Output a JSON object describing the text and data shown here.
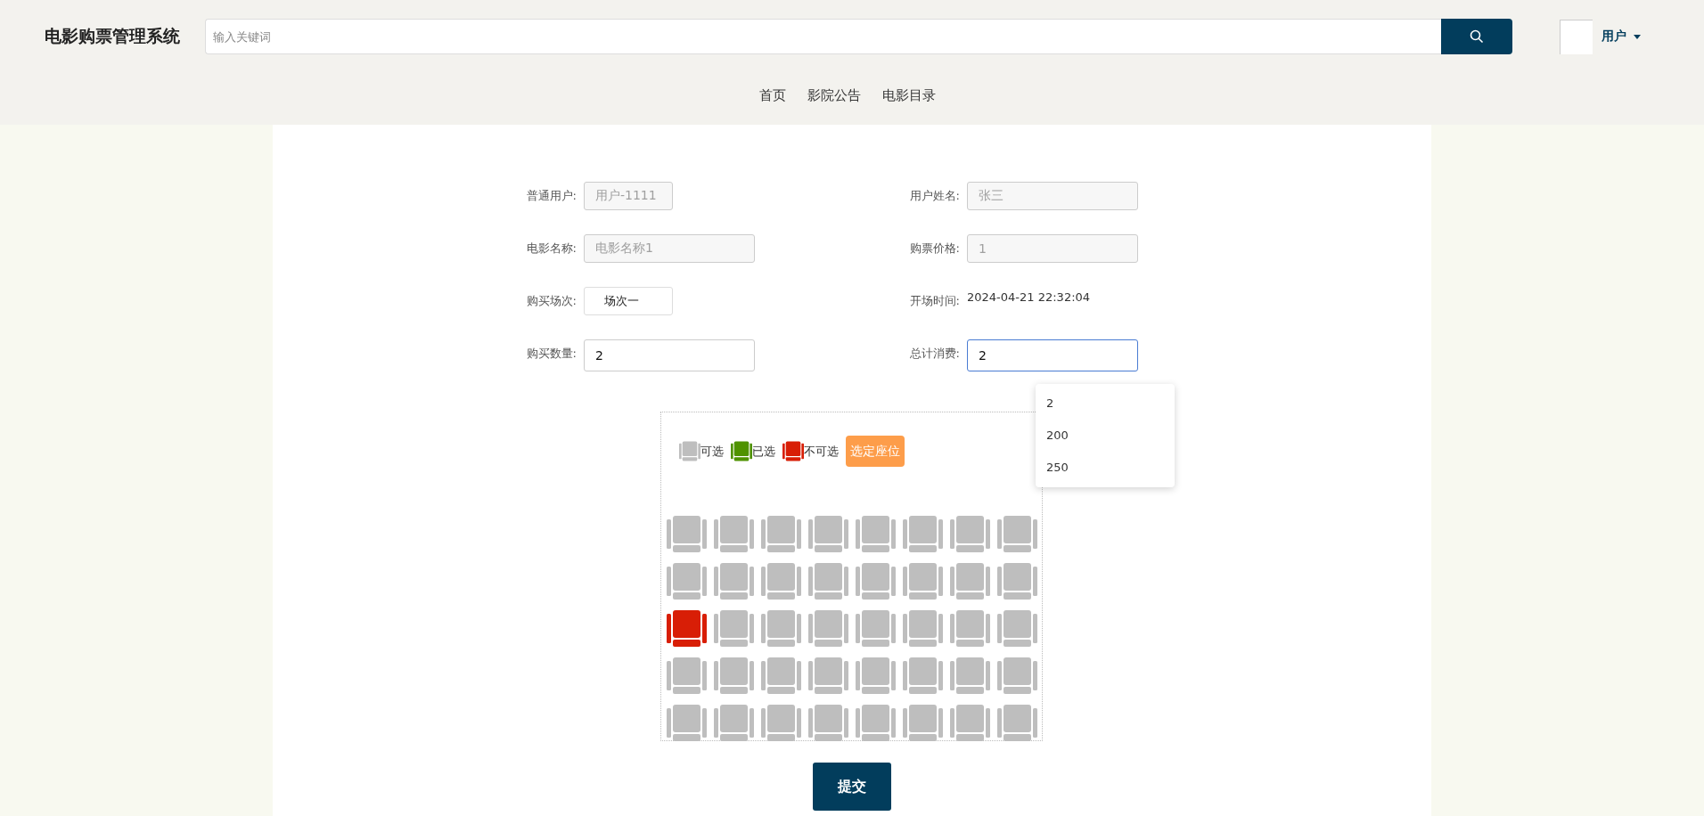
{
  "header": {
    "title": "电影购票管理系统",
    "search": {
      "placeholder": "输入关键词"
    },
    "user": {
      "label": "用户"
    }
  },
  "nav": [
    {
      "label": "首页"
    },
    {
      "label": "影院公告"
    },
    {
      "label": "电影目录"
    }
  ],
  "form": {
    "fields": [
      {
        "label": "普通用户:",
        "kind": "compact",
        "value": "用户-1111",
        "disabled": true,
        "focused": false
      },
      {
        "label": "用户姓名:",
        "kind": "input",
        "value": "张三",
        "disabled": true,
        "focused": false
      },
      {
        "label": "电影名称:",
        "kind": "input",
        "value": "电影名称1",
        "disabled": true,
        "focused": false
      },
      {
        "label": "购票价格:",
        "kind": "input",
        "value": "1",
        "disabled": true,
        "focused": false
      },
      {
        "label": "购买场次:",
        "kind": "select",
        "value": "场次一"
      },
      {
        "label": "开场时间:",
        "kind": "text",
        "value": "2024-04-21 22:32:04"
      },
      {
        "label": "购买数量:",
        "kind": "input",
        "value": "2",
        "disabled": false,
        "focused": false
      },
      {
        "label": "总计消费:",
        "kind": "input",
        "value": "2",
        "disabled": false,
        "focused": true
      }
    ],
    "suggestions": [
      {
        "label": "2"
      },
      {
        "label": "200"
      },
      {
        "label": "250"
      }
    ]
  },
  "seat_map": {
    "legend": [
      {
        "label": "可选",
        "kind": "available"
      },
      {
        "label": "已选",
        "kind": "chosen"
      },
      {
        "label": "不可选",
        "kind": "blocked"
      }
    ],
    "confirm_button": "选定座位",
    "rows": [
      [
        {
          "kind": "available"
        },
        {
          "kind": "available"
        },
        {
          "kind": "available"
        },
        {
          "kind": "available"
        },
        {
          "kind": "available"
        },
        {
          "kind": "available"
        },
        {
          "kind": "available"
        },
        {
          "kind": "available"
        }
      ],
      [
        {
          "kind": "available"
        },
        {
          "kind": "available"
        },
        {
          "kind": "available"
        },
        {
          "kind": "available"
        },
        {
          "kind": "available"
        },
        {
          "kind": "available"
        },
        {
          "kind": "available"
        },
        {
          "kind": "available"
        }
      ],
      [
        {
          "kind": "blocked"
        },
        {
          "kind": "available"
        },
        {
          "kind": "available"
        },
        {
          "kind": "available"
        },
        {
          "kind": "available"
        },
        {
          "kind": "available"
        },
        {
          "kind": "available"
        },
        {
          "kind": "available"
        }
      ],
      [
        {
          "kind": "available"
        },
        {
          "kind": "available"
        },
        {
          "kind": "available"
        },
        {
          "kind": "available"
        },
        {
          "kind": "available"
        },
        {
          "kind": "available"
        },
        {
          "kind": "available"
        },
        {
          "kind": "available"
        }
      ],
      [
        {
          "kind": "available"
        },
        {
          "kind": "available"
        },
        {
          "kind": "available"
        },
        {
          "kind": "available"
        },
        {
          "kind": "available"
        },
        {
          "kind": "available"
        },
        {
          "kind": "available"
        },
        {
          "kind": "available"
        }
      ]
    ]
  },
  "submit_button": "提交"
}
